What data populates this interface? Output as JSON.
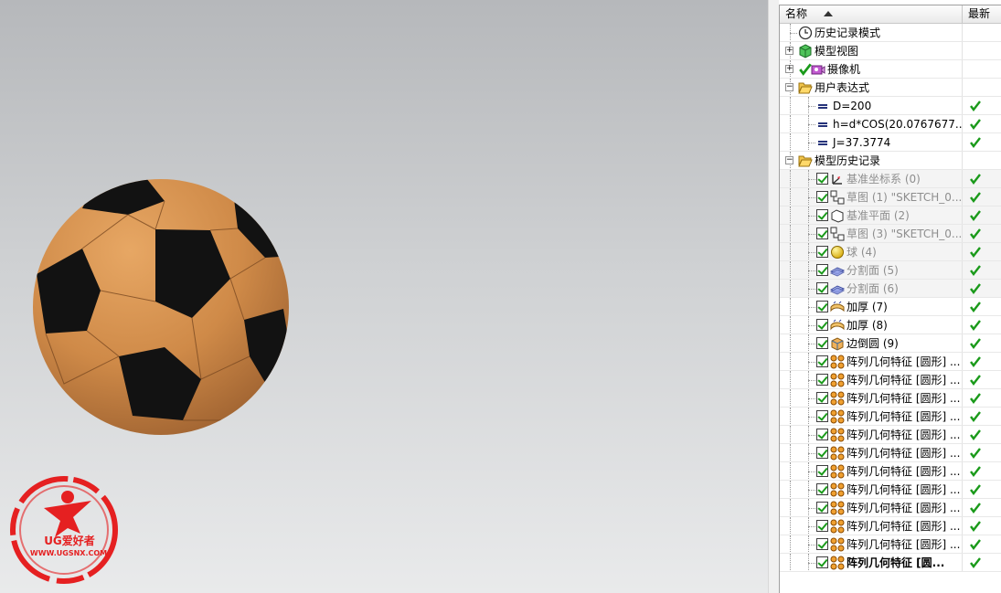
{
  "navigator": {
    "header": {
      "name_col": "名称",
      "latest_col": "最新"
    },
    "rows": [
      {
        "label": "历史记录模式",
        "icon": "clock-icon",
        "level": 0,
        "expander": "none",
        "check": false,
        "latest": false,
        "style": "normal"
      },
      {
        "label": "模型视图",
        "icon": "model-view-icon",
        "level": 0,
        "expander": "plus",
        "check": false,
        "latest": false,
        "style": "normal"
      },
      {
        "label": "摄像机",
        "icon": "camera-icon",
        "level": 0,
        "expander": "plus",
        "check": false,
        "latest": false,
        "style": "normal",
        "prefix_check": true
      },
      {
        "label": "用户表达式",
        "icon": "folder-open-icon",
        "level": 0,
        "expander": "minus",
        "check": false,
        "latest": false,
        "style": "normal"
      },
      {
        "label": "D=200",
        "icon": "expression-icon",
        "level": 1,
        "expander": "none",
        "check": false,
        "latest": true,
        "style": "normal"
      },
      {
        "label": "h=d*COS(20.0767677...",
        "icon": "expression-icon",
        "level": 1,
        "expander": "none",
        "check": false,
        "latest": true,
        "style": "normal"
      },
      {
        "label": "J=37.3774",
        "icon": "expression-icon",
        "level": 1,
        "expander": "none",
        "check": false,
        "latest": true,
        "style": "normal"
      },
      {
        "label": "模型历史记录",
        "icon": "folder-open-icon",
        "level": 0,
        "expander": "minus",
        "check": false,
        "latest": false,
        "style": "normal"
      },
      {
        "label": "基准坐标系 (0)",
        "icon": "datum-csys-icon",
        "level": 1,
        "expander": "none",
        "check": true,
        "latest": true,
        "style": "gray"
      },
      {
        "label": "草图 (1) \"SKETCH_0...",
        "icon": "sketch-icon",
        "level": 1,
        "expander": "none",
        "check": true,
        "latest": true,
        "style": "gray"
      },
      {
        "label": "基准平面 (2)",
        "icon": "datum-plane-icon",
        "level": 1,
        "expander": "none",
        "check": true,
        "latest": true,
        "style": "gray"
      },
      {
        "label": "草图 (3) \"SKETCH_0...",
        "icon": "sketch-icon",
        "level": 1,
        "expander": "none",
        "check": true,
        "latest": true,
        "style": "gray"
      },
      {
        "label": "球 (4)",
        "icon": "sphere-icon",
        "level": 1,
        "expander": "none",
        "check": true,
        "latest": true,
        "style": "gray"
      },
      {
        "label": "分割面 (5)",
        "icon": "divide-face-icon",
        "level": 1,
        "expander": "none",
        "check": true,
        "latest": true,
        "style": "gray"
      },
      {
        "label": "分割面 (6)",
        "icon": "divide-face-icon",
        "level": 1,
        "expander": "none",
        "check": true,
        "latest": true,
        "style": "gray"
      },
      {
        "label": "加厚 (7)",
        "icon": "thicken-icon",
        "level": 1,
        "expander": "none",
        "check": true,
        "latest": true,
        "style": "normal"
      },
      {
        "label": "加厚 (8)",
        "icon": "thicken-icon",
        "level": 1,
        "expander": "none",
        "check": true,
        "latest": true,
        "style": "normal"
      },
      {
        "label": "边倒圆 (9)",
        "icon": "edge-blend-icon",
        "level": 1,
        "expander": "none",
        "check": true,
        "latest": true,
        "style": "normal"
      },
      {
        "label": "阵列几何特征 [圆形] ...",
        "icon": "pattern-geometry-icon",
        "level": 1,
        "expander": "none",
        "check": true,
        "latest": true,
        "style": "normal"
      },
      {
        "label": "阵列几何特征 [圆形] ...",
        "icon": "pattern-geometry-icon",
        "level": 1,
        "expander": "none",
        "check": true,
        "latest": true,
        "style": "normal"
      },
      {
        "label": "阵列几何特征 [圆形] ...",
        "icon": "pattern-geometry-icon",
        "level": 1,
        "expander": "none",
        "check": true,
        "latest": true,
        "style": "normal"
      },
      {
        "label": "阵列几何特征 [圆形] ...",
        "icon": "pattern-geometry-icon",
        "level": 1,
        "expander": "none",
        "check": true,
        "latest": true,
        "style": "normal"
      },
      {
        "label": "阵列几何特征 [圆形] ...",
        "icon": "pattern-geometry-icon",
        "level": 1,
        "expander": "none",
        "check": true,
        "latest": true,
        "style": "normal"
      },
      {
        "label": "阵列几何特征 [圆形] ...",
        "icon": "pattern-geometry-icon",
        "level": 1,
        "expander": "none",
        "check": true,
        "latest": true,
        "style": "normal"
      },
      {
        "label": "阵列几何特征 [圆形] ...",
        "icon": "pattern-geometry-icon",
        "level": 1,
        "expander": "none",
        "check": true,
        "latest": true,
        "style": "normal"
      },
      {
        "label": "阵列几何特征 [圆形] ...",
        "icon": "pattern-geometry-icon",
        "level": 1,
        "expander": "none",
        "check": true,
        "latest": true,
        "style": "normal"
      },
      {
        "label": "阵列几何特征 [圆形] ...",
        "icon": "pattern-geometry-icon",
        "level": 1,
        "expander": "none",
        "check": true,
        "latest": true,
        "style": "normal"
      },
      {
        "label": "阵列几何特征 [圆形] ...",
        "icon": "pattern-geometry-icon",
        "level": 1,
        "expander": "none",
        "check": true,
        "latest": true,
        "style": "normal"
      },
      {
        "label": "阵列几何特征 [圆形] ...",
        "icon": "pattern-geometry-icon",
        "level": 1,
        "expander": "none",
        "check": true,
        "latest": true,
        "style": "normal"
      },
      {
        "label": "阵列几何特征 [圆...",
        "icon": "pattern-geometry-icon",
        "level": 1,
        "expander": "none",
        "check": true,
        "latest": true,
        "style": "bold"
      }
    ]
  },
  "logo": {
    "name": "UG爱好者",
    "url": "WWW.UGSNX.COM"
  },
  "colors": {
    "ball_orange": "#d08a48",
    "ball_black": "#111111",
    "check_green": "#1a9a1a",
    "logo_red": "#e52021"
  }
}
